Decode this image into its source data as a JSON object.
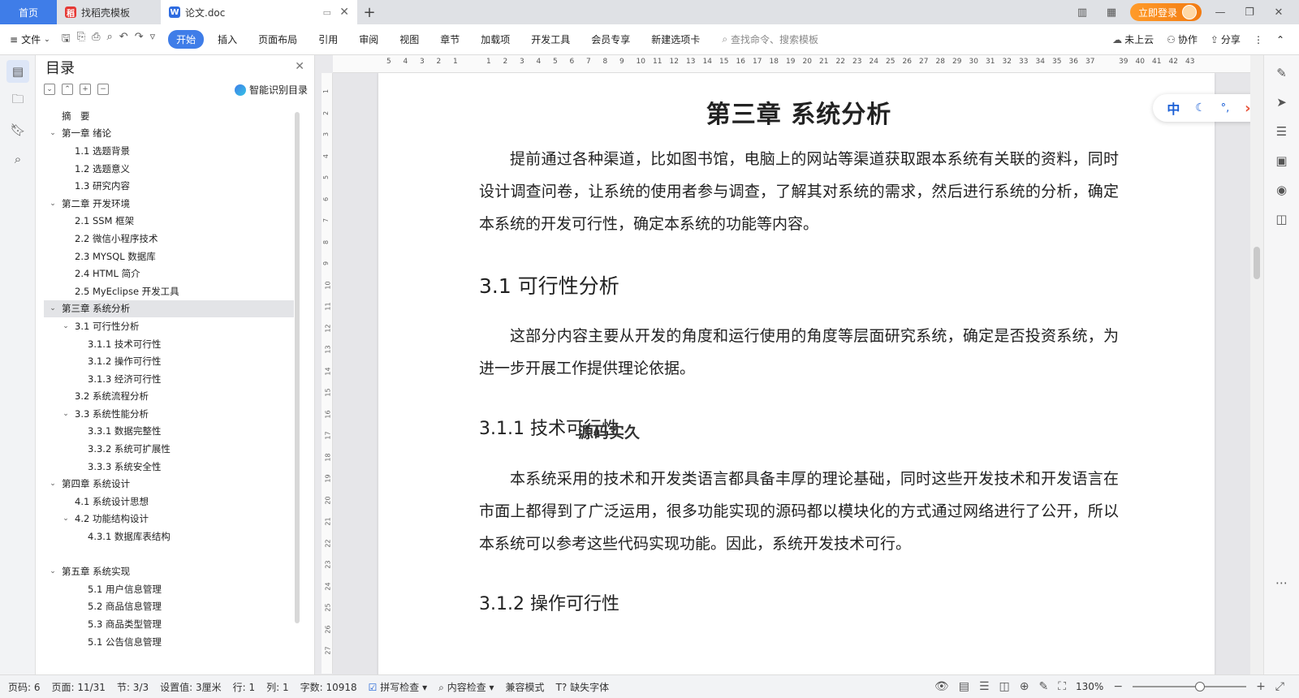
{
  "tabs": {
    "home": "首页",
    "template": "找稻壳模板",
    "doc": "论文.doc",
    "login": "立即登录"
  },
  "menu": {
    "file": "文件",
    "items": [
      "开始",
      "插入",
      "页面布局",
      "引用",
      "审阅",
      "视图",
      "章节",
      "加载项",
      "开发工具",
      "会员专享",
      "新建选项卡"
    ],
    "search_placeholder": "查找命令、搜索模板",
    "cloud": "未上云",
    "collab": "协作",
    "share": "分享"
  },
  "toc": {
    "title": "目录",
    "smart": "智能识别目录",
    "items": [
      {
        "text": "摘　要",
        "level": 1,
        "chev": false
      },
      {
        "text": "第一章  绪论",
        "level": 1,
        "chev": true
      },
      {
        "text": "1.1  选题背景",
        "level": 2,
        "chev": false
      },
      {
        "text": "1.2  选题意义",
        "level": 2,
        "chev": false
      },
      {
        "text": "1.3  研究内容",
        "level": 2,
        "chev": false
      },
      {
        "text": "第二章  开发环境",
        "level": 1,
        "chev": true
      },
      {
        "text": "2.1 SSM 框架",
        "level": 2,
        "chev": false
      },
      {
        "text": "2.2 微信小程序技术",
        "level": 2,
        "chev": false
      },
      {
        "text": "2.3 MYSQL 数据库",
        "level": 2,
        "chev": false
      },
      {
        "text": "2.4 HTML 简介",
        "level": 2,
        "chev": false
      },
      {
        "text": "2.5 MyEclipse 开发工具",
        "level": 2,
        "chev": false
      },
      {
        "text": "第三章  系统分析",
        "level": 1,
        "chev": true,
        "selected": true
      },
      {
        "text": "3.1 可行性分析",
        "level": 2,
        "chev": true
      },
      {
        "text": "3.1.1 技术可行性",
        "level": 3,
        "chev": false
      },
      {
        "text": "3.1.2 操作可行性",
        "level": 3,
        "chev": false
      },
      {
        "text": "3.1.3 经济可行性",
        "level": 3,
        "chev": false
      },
      {
        "text": "3.2 系统流程分析",
        "level": 2,
        "chev": false
      },
      {
        "text": "3.3 系统性能分析",
        "level": 2,
        "chev": true
      },
      {
        "text": "3.3.1 数据完整性",
        "level": 3,
        "chev": false
      },
      {
        "text": "3.3.2 系统可扩展性",
        "level": 3,
        "chev": false
      },
      {
        "text": "3.3.3 系统安全性",
        "level": 3,
        "chev": false
      },
      {
        "text": "第四章  系统设计",
        "level": 1,
        "chev": true
      },
      {
        "text": "4.1  系统设计思想",
        "level": 2,
        "chev": false
      },
      {
        "text": "4.2 功能结构设计",
        "level": 2,
        "chev": true
      },
      {
        "text": "4.3.1  数据库表结构",
        "level": 3,
        "chev": false
      },
      {
        "text": "",
        "level": 1,
        "chev": false
      },
      {
        "text": "第五章  系统实现",
        "level": 1,
        "chev": true
      },
      {
        "text": "5.1 用户信息管理",
        "level": 3,
        "chev": false
      },
      {
        "text": "5.2  商品信息管理",
        "level": 3,
        "chev": false
      },
      {
        "text": "5.3 商品类型管理",
        "level": 3,
        "chev": false
      },
      {
        "text": "5.1 公告信息管理",
        "level": 3,
        "chev": false
      }
    ]
  },
  "ruler": {
    "h": [
      "5",
      "4",
      "3",
      "2",
      "1",
      "",
      "1",
      "2",
      "3",
      "4",
      "5",
      "6",
      "7",
      "8",
      "9",
      "10",
      "11",
      "12",
      "13",
      "14",
      "15",
      "16",
      "17",
      "18",
      "19",
      "20",
      "21",
      "22",
      "23",
      "24",
      "25",
      "26",
      "27",
      "28",
      "29",
      "30",
      "31",
      "32",
      "33",
      "34",
      "35",
      "36",
      "37",
      "",
      "39",
      "40",
      "41",
      "42",
      "43"
    ],
    "v": [
      "1",
      "2",
      "3",
      "4",
      "5",
      "6",
      "7",
      "8",
      "9",
      "10",
      "11",
      "12",
      "13",
      "14",
      "15",
      "16",
      "17",
      "18",
      "19",
      "20",
      "21",
      "22",
      "23",
      "24",
      "25",
      "26",
      "27"
    ]
  },
  "doc": {
    "chapter_title": "第三章  系统分析",
    "p1": "提前通过各种渠道，比如图书馆，电脑上的网站等渠道获取跟本系统有关联的资料，同时设计调查问卷，让系统的使用者参与调查，了解其对系统的需求，然后进行系统的分析，确定本系统的开发可行性，确定本系统的功能等内容。",
    "h31": "3.1 可行性分析",
    "p2": "这部分内容主要从开发的角度和运行使用的角度等层面研究系统，确定是否投资系统，为进一步开展工作提供理论依据。",
    "watermark": "源码实久",
    "h311": "3.1.1 技术可行性",
    "p3": "本系统采用的技术和开发类语言都具备丰厚的理论基础，同时这些开发技术和开发语言在市面上都得到了广泛运用，很多功能实现的源码都以模块化的方式通过网络进行了公开，所以本系统可以参考这些代码实现功能。因此，系统开发技术可行。",
    "h312": "3.1.2 操作可行性"
  },
  "ime": {
    "lang": "中"
  },
  "status": {
    "page_code": "页码: 6",
    "page": "页面: 11/31",
    "section": "节: 3/3",
    "setting": "设置值: 3厘米",
    "row": "行: 1",
    "col": "列: 1",
    "words": "字数: 10918",
    "spell": "拼写检查",
    "content_check": "内容检查",
    "compat": "兼容模式",
    "missing_font": "缺失字体",
    "zoom": "130%",
    "zoom_level": 0.6
  },
  "colors": {
    "accent": "#3f7de8",
    "login": "#f27b12"
  }
}
